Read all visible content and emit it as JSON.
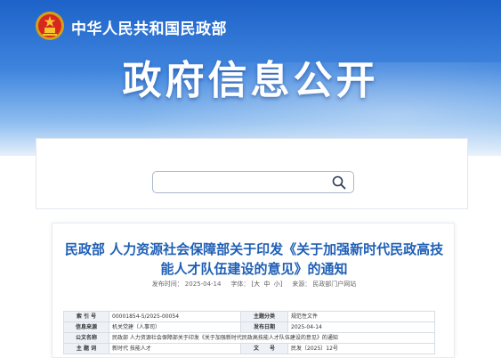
{
  "header": {
    "ministry_name": "中华人民共和国民政部",
    "portal_title": "政府信息公开",
    "colors": {
      "banner_top": "#1d62c8",
      "banner_bottom": "#e6f0fb",
      "title_blue": "#1f5fb6"
    }
  },
  "search": {
    "value": "",
    "placeholder": "",
    "icon": "search-icon"
  },
  "article": {
    "title": "民政部 人力资源社会保障部关于印发《关于加强新时代民政高技能人才队伍建设的意见》的通知",
    "meta": {
      "publish_label": "发布时间：",
      "publish_date": "2025-04-14",
      "font_label": "字体：",
      "font_big": "[大",
      "font_mid": "中",
      "font_small": "小]",
      "source_label": "来源：",
      "source": "民政部门户网站"
    },
    "info": [
      {
        "label1": "索 引 号",
        "value1": "00001854-5/2025-00054",
        "label2": "主题分类",
        "value2": "规范性文件"
      },
      {
        "label1": "信息来源",
        "value1": "机关党建（人事司）",
        "label2": "发布日期",
        "value2": "2025-04-14"
      },
      {
        "label1": "公文名称",
        "value1": "民政部 人力资源社会保障部关于印发《关于加强新时代民政高技能人才队伍建设的意见》的通知",
        "label2": "",
        "value2": ""
      },
      {
        "label1": "主 题 词",
        "value1": "新时代 技能人才",
        "label2": "文　　号",
        "value2": "民发〔2025〕12号"
      }
    ]
  }
}
